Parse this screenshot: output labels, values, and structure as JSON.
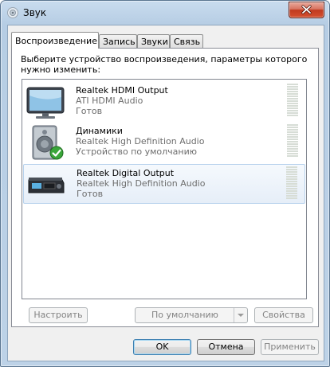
{
  "window": {
    "title": "Звук"
  },
  "tabs": [
    {
      "label": "Воспроизведение",
      "active": true
    },
    {
      "label": "Запись"
    },
    {
      "label": "Звуки"
    },
    {
      "label": "Связь"
    }
  ],
  "instruction": "Выберите устройство воспроизведения, параметры которого нужно изменить:",
  "devices": [
    {
      "name": "Realtek HDMI Output",
      "driver": "ATI HDMI Audio",
      "status": "Готов",
      "icon": "monitor-icon"
    },
    {
      "name": "Динамики",
      "driver": "Realtek High Definition Audio",
      "status": "Устройство по умолчанию",
      "icon": "speaker-icon",
      "default": true
    },
    {
      "name": "Realtek Digital Output",
      "driver": "Realtek High Definition Audio",
      "status": "Готов",
      "icon": "receiver-icon",
      "selected": true
    }
  ],
  "buttons": {
    "configure": "Настроить",
    "set_default": "По умолчанию",
    "properties": "Свойства",
    "ok": "OK",
    "cancel": "Отмена",
    "apply": "Применить"
  },
  "colors": {
    "selection_border": "#b8d2ed",
    "check_green": "#3aa63a",
    "close_red": "#c0391f"
  }
}
